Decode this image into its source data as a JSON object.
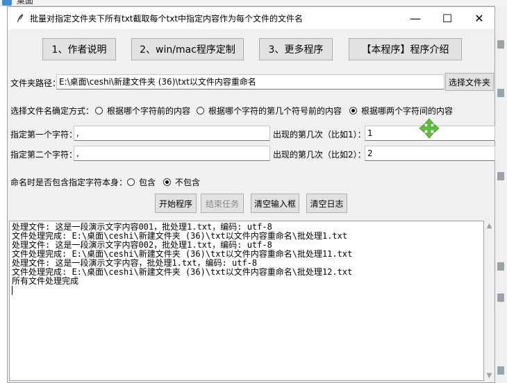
{
  "desktop": {
    "label": "桌面"
  },
  "window": {
    "title": "批量对指定文件夹下所有txt截取每个txt中指定内容作为每个文件的文件名",
    "controls": {
      "minimize": "—",
      "maximize": "☐",
      "close": "✕"
    }
  },
  "top_buttons": [
    "1、作者说明",
    "2、win/mac程序定制",
    "3、更多程序",
    "【本程序】程序介绍"
  ],
  "folder": {
    "label": "文件夹路径：",
    "value": "E:\\桌面\\ceshi\\新建文件夹 (36)\\txt以文件内容重命名",
    "browse_button": "选择文件夹"
  },
  "mode": {
    "label": "选择文件名确定方式：",
    "options": [
      "根据哪个字符前的内容",
      "根据哪个字符的第几个符号前的内容",
      "根据哪两个字符间的内容"
    ],
    "selected_index": 2
  },
  "char1": {
    "label": "指定第一个字符：",
    "value": ",",
    "occ_label": "出现的第几次（比如1）：",
    "occ_value": "1"
  },
  "char2": {
    "label": "指定第二个字符：",
    "value": ",",
    "occ_label": "出现的第几次（比如2）：",
    "occ_value": "2"
  },
  "include": {
    "label": "命名时是否包含指定字符本身：",
    "options": [
      "包含",
      "不包含"
    ],
    "selected_index": 1
  },
  "actions": {
    "start": "开始程序",
    "stop": "结束任务",
    "clear_inputs": "清空输入框",
    "clear_log": "清空日志"
  },
  "log": {
    "lines": [
      "处理文件: 这是一段演示文字内容001，批处理1.txt，编码: utf-8",
      "文件处理完成: E:\\桌面\\ceshi\\新建文件夹 (36)\\txt以文件内容重命名\\批处理1.txt",
      "处理文件: 这是一段演示文字内容002，批处理1.txt，编码: utf-8",
      "文件处理完成: E:\\桌面\\ceshi\\新建文件夹 (36)\\txt以文件内容重命名\\批处理11.txt",
      "处理文件: 这是一段演示文字内容，批处理1.txt，编码: utf-8",
      "文件处理完成: E:\\桌面\\ceshi\\新建文件夹 (36)\\txt以文件内容重命名\\批处理12.txt",
      "所有文件处理完成"
    ]
  },
  "colors": {
    "move_icon": "#5fc338",
    "window_bg": "#f0f0f0",
    "button_bg": "#e1e1e1"
  }
}
